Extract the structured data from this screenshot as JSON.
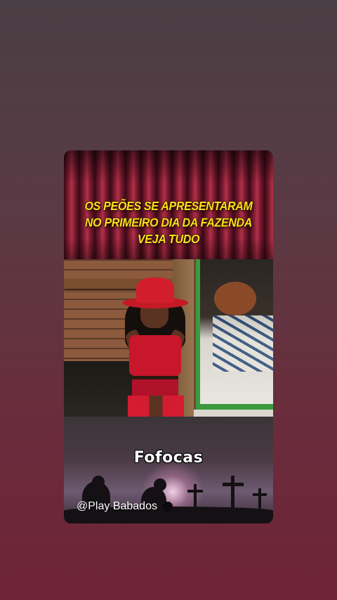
{
  "post": {
    "headline_lines": [
      "OS PEÕES SE APRESENTARAM",
      "NO PRIMEIRO DIA DA FAZENDA",
      "VEJA TUDO"
    ],
    "brand": "Fofocas",
    "handle": "@Play Babados"
  },
  "colors": {
    "headline": "#f5e21a",
    "background_top": "#4a3f44",
    "background_bottom": "#6e2436",
    "curtain": "#7a1a2e"
  },
  "icons": {
    "handle_icon": "rose-icon"
  }
}
